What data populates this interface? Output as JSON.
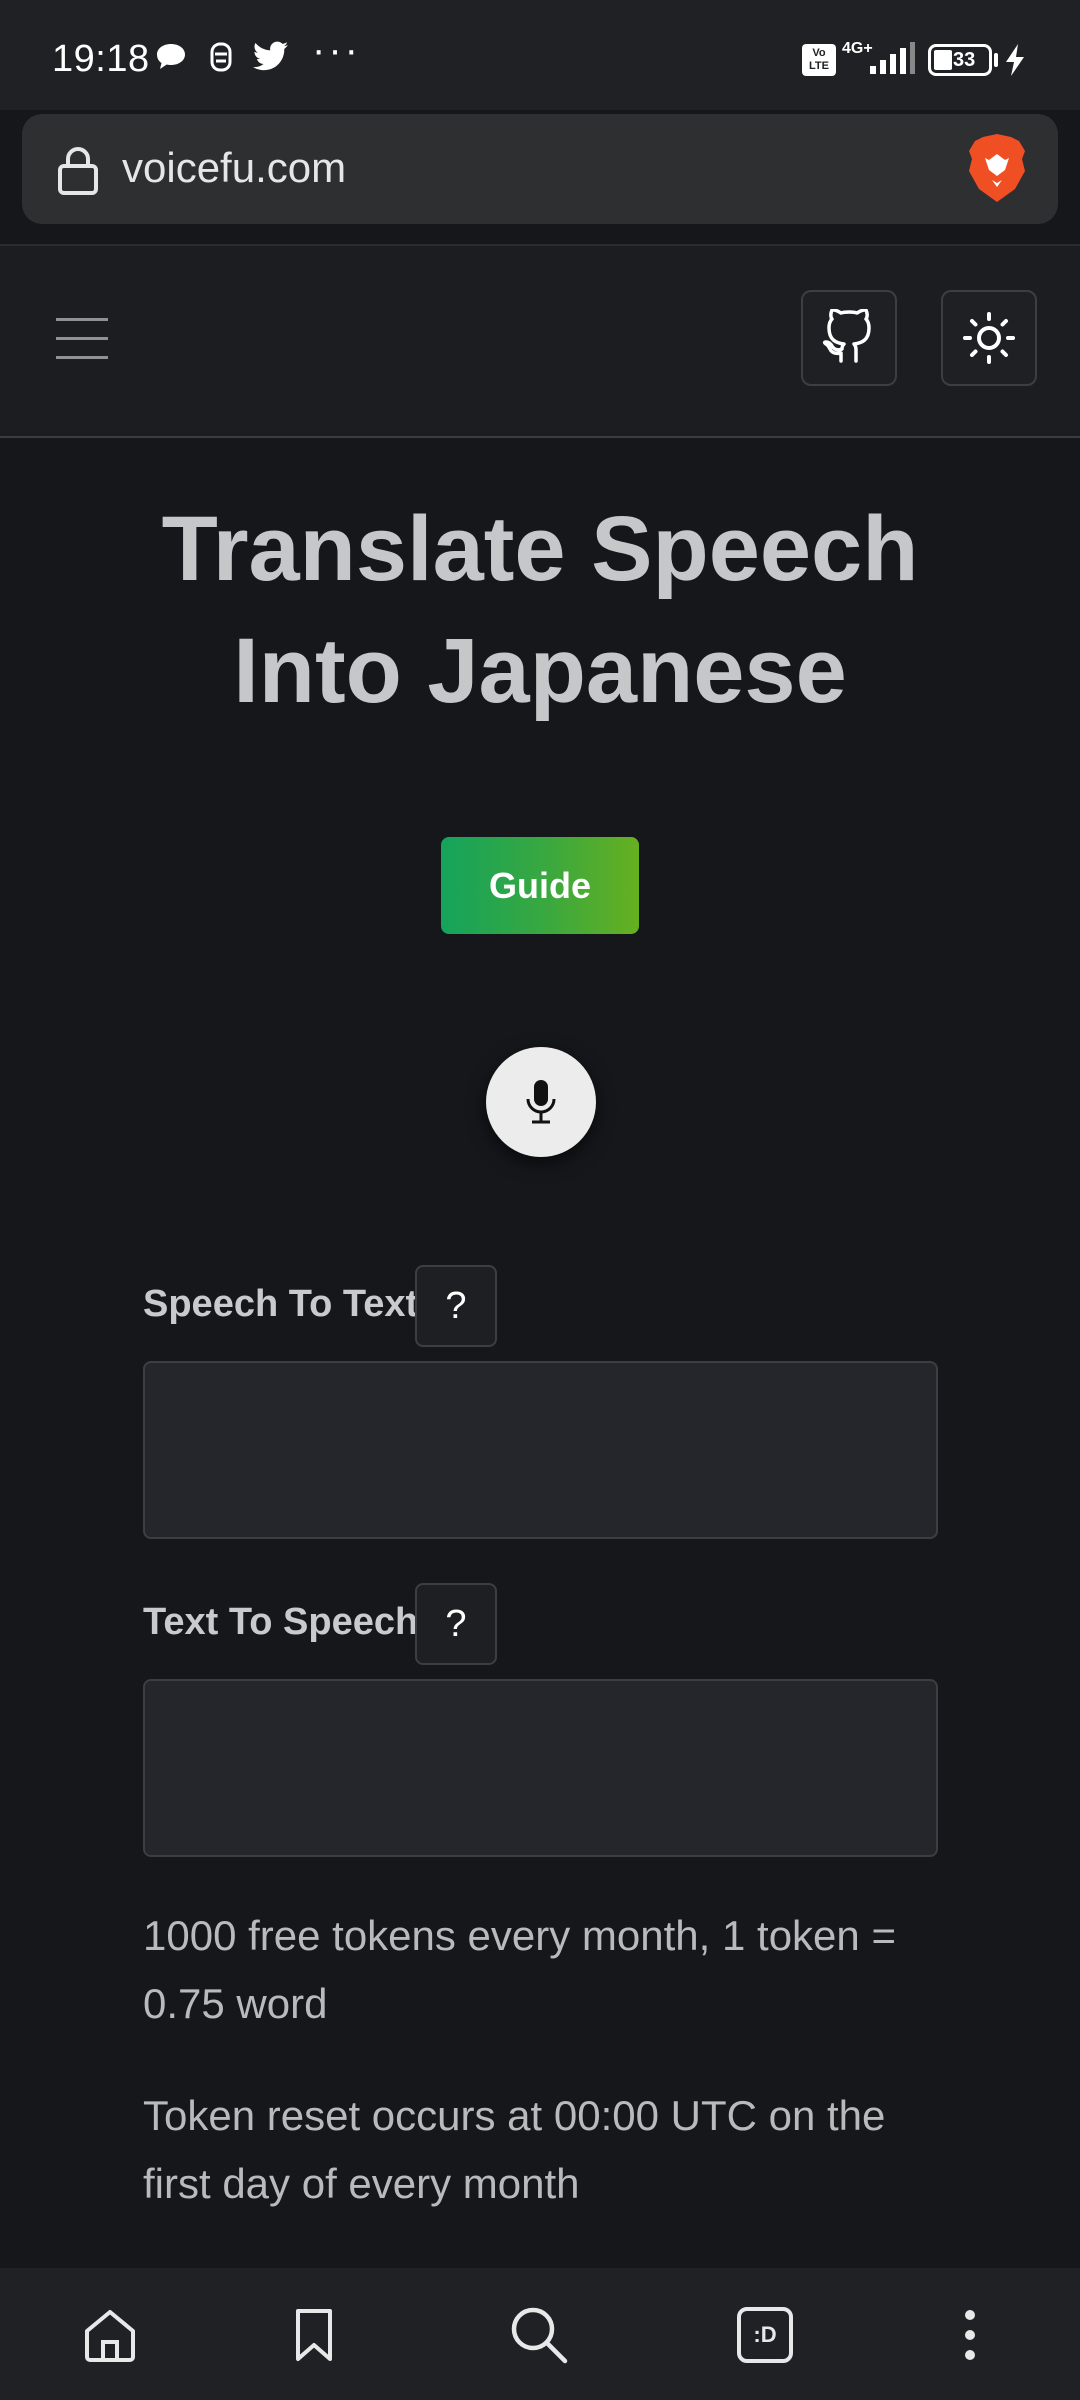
{
  "status_bar": {
    "time": "19:18",
    "network": "4G+",
    "volte": "Vo LTE",
    "battery": "33",
    "more": "···"
  },
  "browser": {
    "url": "voicefu.com"
  },
  "main": {
    "title_line1": "Translate Speech",
    "title_line2": "Into Japanese",
    "guide_label": "Guide",
    "speech_to_text_label": "Speech To Text",
    "speech_to_text_value": "",
    "text_to_speech_label": "Text To Speech",
    "text_to_speech_value": "",
    "help_label": "?",
    "tokens_info": "1000 free tokens every month, 1 token = 0.75 word",
    "reset_info": "Token reset occurs at 00:00 UTC on the first day of every month"
  },
  "bottom_nav": {
    "tabs_label": ":D"
  },
  "colors": {
    "background": "#15171b",
    "header": "#1b1d21",
    "guide_gradient_start": "#15a35c",
    "guide_gradient_end": "#66b020"
  }
}
